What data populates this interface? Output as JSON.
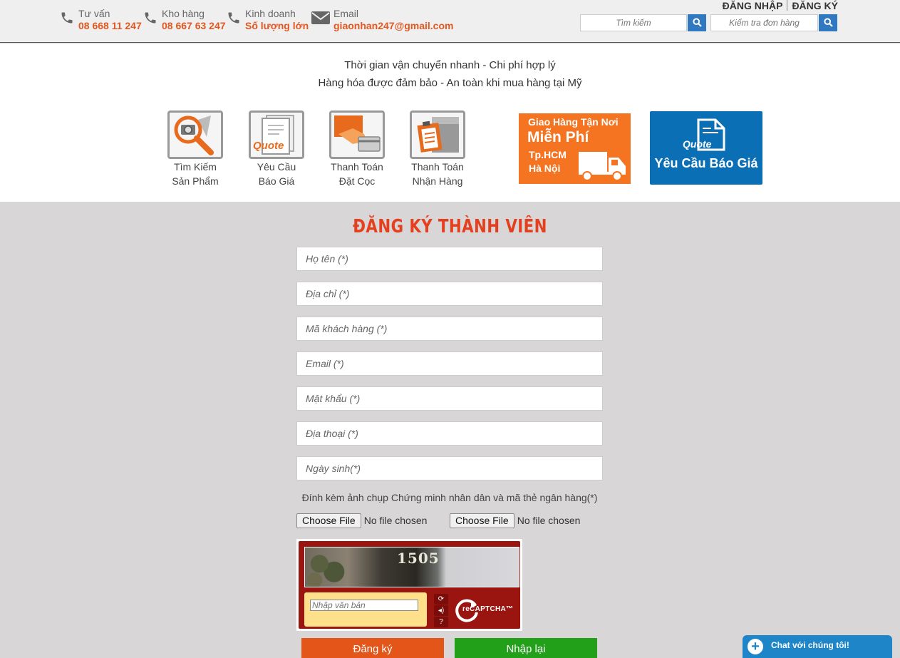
{
  "header": {
    "contacts": [
      {
        "label": "Tư vấn",
        "value": "08 668 11 247",
        "icon": "phone-icon"
      },
      {
        "label": "Kho hàng",
        "value": "08 667 63 247",
        "icon": "phone-icon"
      },
      {
        "label": "Kinh doanh",
        "value": "Số lượng lớn",
        "icon": "phone-icon"
      },
      {
        "label": "Email",
        "value": "giaonhan247@gmail.com",
        "icon": "envelope-icon"
      }
    ],
    "login_label": "ĐĂNG NHẬP",
    "register_label": "ĐĂNG KÝ",
    "search_placeholder": "Tìm kiếm",
    "order_check_placeholder": "Kiểm tra đơn hàng"
  },
  "banner": {
    "slogan_line1": "Thời gian vận chuyển nhanh - Chi phí hợp lý",
    "slogan_line2": "Hàng hóa được đảm bảo - An toàn khi mua hàng tại Mỹ",
    "features": [
      {
        "line1": "Tìm Kiếm",
        "line2": "Sản Phẩm",
        "icon": "magnifier-camera-icon"
      },
      {
        "line1": "Yêu Cầu",
        "line2": "Báo Giá",
        "icon": "quote-document-icon"
      },
      {
        "line1": "Thanh Toán",
        "line2": "Đặt Cọc",
        "icon": "card-payment-icon"
      },
      {
        "line1": "Thanh Toán",
        "line2": "Nhận Hàng",
        "icon": "clipboard-box-icon"
      }
    ],
    "quote_badge": "Quote",
    "promo_delivery": {
      "line1": "Giao Hàng Tận Nơi",
      "line2": "Miễn Phí",
      "line3": "Tp.HCM",
      "line4": "Hà Nội"
    },
    "promo_quote": {
      "badge": "Quote",
      "label": "Yêu Cầu Báo Giá"
    }
  },
  "form": {
    "title": "ĐĂNG KÝ THÀNH VIÊN",
    "fields": {
      "fullname": "Họ tên (*)",
      "address": "Địa chỉ (*)",
      "customer_code": "Mã khách hàng (*)",
      "email": "Email (*)",
      "password": "Mật khẩu (*)",
      "phone": "Địa thoại (*)",
      "birthday": "Ngày sinh(*)"
    },
    "attach_label": "Đính kèm ảnh chụp Chứng minh nhân dân và mã thẻ ngân hàng(*)",
    "choose_file_label": "Choose File",
    "no_file_label": "No file chosen",
    "captcha": {
      "image_text": "1505",
      "input_placeholder": "Nhập văn bản",
      "brand": "reCAPTCHA™"
    },
    "submit_label": "Đăng ký",
    "reset_label": "Nhập lại"
  },
  "chat": {
    "label": "Chat với chúng tôi!"
  },
  "colors": {
    "accent_orange": "#e4571f",
    "title_red": "#e4401f",
    "search_blue": "#3078c0",
    "submit_orange": "#e4551a",
    "reset_green": "#23a01a",
    "chat_blue": "#1d85c8"
  }
}
